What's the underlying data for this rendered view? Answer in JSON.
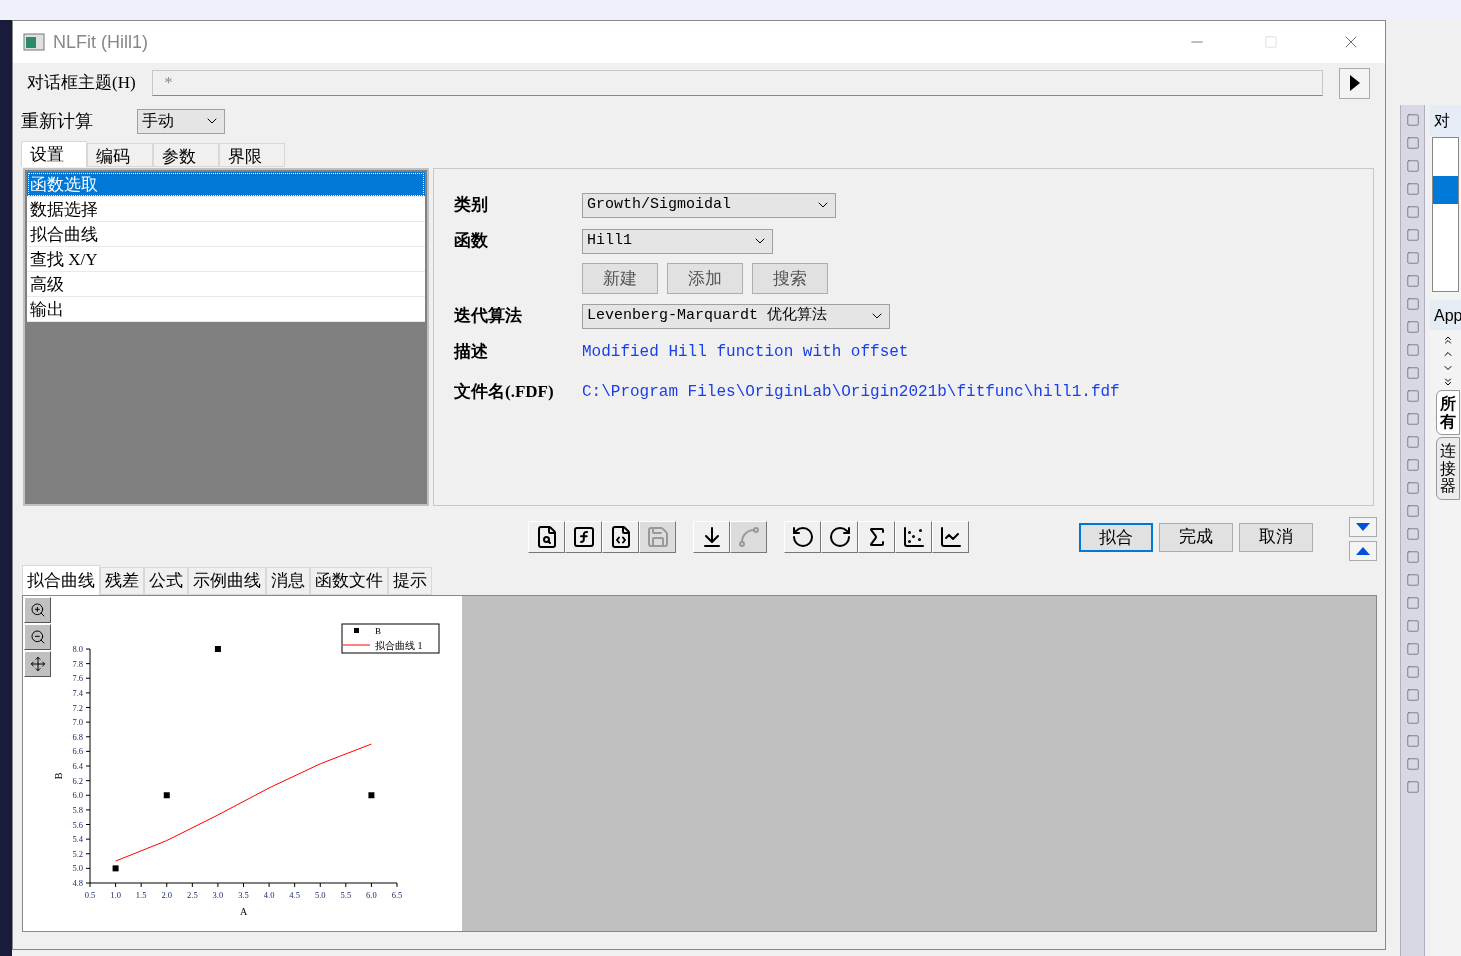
{
  "window": {
    "title": "NLFit (Hill1)"
  },
  "theme": {
    "label": "对话框主题(H)",
    "placeholder": "*"
  },
  "recalc": {
    "label": "重新计算",
    "value": "手动"
  },
  "tabs": [
    {
      "label": "设置",
      "selected": true
    },
    {
      "label": "编码",
      "selected": false
    },
    {
      "label": "参数",
      "selected": false
    },
    {
      "label": "界限",
      "selected": false
    }
  ],
  "nav_items": [
    {
      "label": "函数选取",
      "selected": true
    },
    {
      "label": "数据选择",
      "selected": false
    },
    {
      "label": "拟合曲线",
      "selected": false
    },
    {
      "label": "查找 X/Y",
      "selected": false
    },
    {
      "label": "高级",
      "selected": false
    },
    {
      "label": "输出",
      "selected": false
    }
  ],
  "form": {
    "category": {
      "label": "类别",
      "value": "Growth/Sigmoidal"
    },
    "function": {
      "label": "函数",
      "value": "Hill1"
    },
    "function_buttons": [
      "新建",
      "添加",
      "搜索"
    ],
    "algorithm": {
      "label": "迭代算法",
      "value": "Levenberg-Marquardt 优化算法"
    },
    "description": {
      "label": "描述",
      "value": "Modified Hill function with offset"
    },
    "file": {
      "label": "文件名(.FDF)",
      "value": "C:\\Program Files\\OriginLab\\Origin2021b\\fitfunc\\hill1.fdf"
    }
  },
  "toolbar": [
    {
      "kind": "tool",
      "disabled": false
    },
    {
      "kind": "tool",
      "disabled": false
    },
    {
      "kind": "tool",
      "disabled": false
    },
    {
      "kind": "tool",
      "disabled": true
    },
    {
      "kind": "gap"
    },
    {
      "kind": "tool",
      "disabled": false
    },
    {
      "kind": "tool",
      "disabled": true
    },
    {
      "kind": "gap"
    },
    {
      "kind": "tool",
      "disabled": false
    },
    {
      "kind": "tool",
      "disabled": false
    },
    {
      "kind": "tool",
      "disabled": false
    },
    {
      "kind": "tool",
      "disabled": false
    },
    {
      "kind": "tool",
      "disabled": false
    }
  ],
  "actions": [
    {
      "label": "拟合",
      "selected": true
    },
    {
      "label": "完成",
      "selected": false
    },
    {
      "label": "取消",
      "selected": false
    }
  ],
  "bottom_tabs": [
    {
      "label": "拟合曲线",
      "selected": true
    },
    {
      "label": "残差",
      "selected": false
    },
    {
      "label": "公式",
      "selected": false
    },
    {
      "label": "示例曲线",
      "selected": false
    },
    {
      "label": "消息",
      "selected": false
    },
    {
      "label": "函数文件",
      "selected": false
    },
    {
      "label": "提示",
      "selected": false
    }
  ],
  "chart_data": {
    "type": "scatter",
    "xlabel": "A",
    "ylabel": "B",
    "x": [
      1,
      2,
      3,
      4,
      5,
      6
    ],
    "series": [
      {
        "name": "B",
        "type": "scatter",
        "color": "#000000",
        "values": [
          5,
          6,
          8,
          null,
          null,
          6
        ]
      },
      {
        "name": "拟合曲线 1",
        "type": "line",
        "color": "#ff0000",
        "values": [
          5.1,
          5.38,
          5.73,
          6.1,
          6.43,
          6.7
        ]
      }
    ],
    "legend": "upper right",
    "xlim": [
      0.5,
      6.5
    ],
    "ylim": [
      4.8,
      8.0
    ],
    "xticks": [
      {
        "value": 0.5,
        "label": "0.5"
      },
      {
        "value": 1,
        "label": "1.0"
      },
      {
        "value": 1.5,
        "label": "1.5"
      },
      {
        "value": 2,
        "label": "2.0"
      },
      {
        "value": 2.5,
        "label": "2.5"
      },
      {
        "value": 3,
        "label": "3.0"
      },
      {
        "value": 3.5,
        "label": "3.5"
      },
      {
        "value": 4,
        "label": "4.0"
      },
      {
        "value": 4.5,
        "label": "4.5"
      },
      {
        "value": 5,
        "label": "5.0"
      },
      {
        "value": 5.5,
        "label": "5.5"
      },
      {
        "value": 6,
        "label": "6.0"
      },
      {
        "value": 6.5,
        "label": "6.5"
      }
    ],
    "yticks": [
      {
        "value": 4.8,
        "label": "4.8"
      },
      {
        "value": 5,
        "label": "5.0"
      },
      {
        "value": 5.2,
        "label": "5.2"
      },
      {
        "value": 5.4,
        "label": "5.4"
      },
      {
        "value": 5.6,
        "label": "5.6"
      },
      {
        "value": 5.8,
        "label": "5.8"
      },
      {
        "value": 6,
        "label": "6.0"
      },
      {
        "value": 6.2,
        "label": "6.2"
      },
      {
        "value": 6.4,
        "label": "6.4"
      },
      {
        "value": 6.6,
        "label": "6.6"
      },
      {
        "value": 6.8,
        "label": "6.8"
      },
      {
        "value": 7,
        "label": "7.0"
      },
      {
        "value": 7.2,
        "label": "7.2"
      },
      {
        "value": 7.4,
        "label": "7.4"
      },
      {
        "value": 7.6,
        "label": "7.6"
      },
      {
        "value": 7.8,
        "label": "7.8"
      },
      {
        "value": 8,
        "label": "8.0"
      }
    ]
  },
  "side_panel": {
    "objects_title": "对",
    "apps_title": "App",
    "vertical_tabs": [
      {
        "label": "所有",
        "selected": true
      },
      {
        "label": "连接器",
        "selected": false
      }
    ]
  }
}
